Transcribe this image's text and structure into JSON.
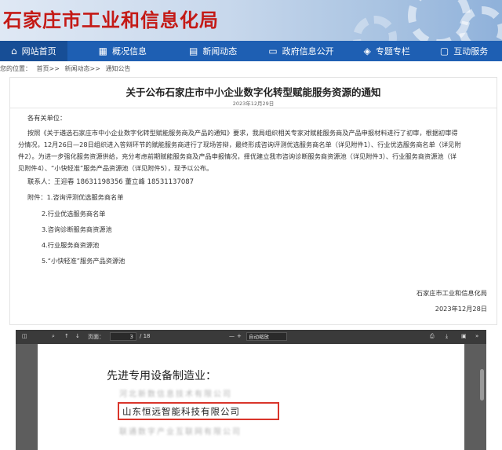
{
  "site": {
    "title": "石家庄市工业和信息化局"
  },
  "nav": [
    {
      "label": "网站首页",
      "icon": "home-icon",
      "glyph": "⌂"
    },
    {
      "label": "概况信息",
      "icon": "grid-icon",
      "glyph": "▦"
    },
    {
      "label": "新闻动态",
      "icon": "newspaper-icon",
      "glyph": "▤"
    },
    {
      "label": "政府信息公开",
      "icon": "monitor-icon",
      "glyph": "▭"
    },
    {
      "label": "专题专栏",
      "icon": "layers-icon",
      "glyph": "◈"
    },
    {
      "label": "互动服务",
      "icon": "chat-icon",
      "glyph": "▢"
    }
  ],
  "breadcrumb": {
    "prefix": "您的位置：",
    "items": [
      "首页>>",
      "新闻动态>>",
      "通知公告"
    ]
  },
  "article": {
    "title": "关于公布石家庄市中小企业数字化转型赋能服务资源的通知",
    "date": "2023年12月29日",
    "greeting": "各有关单位：",
    "lines": [
      "按照《关于遴选石家庄市中小企业数字化转型赋能服务商及产品的通知》要求，我局组织相关专家对赋能服务商及产品申报材料进行了初审，根据初审得",
      "分情况，12月26日—28日组织进入答辩环节的赋能服务商进行了现场答辩，最终形成咨询评测优选服务商名单（详见附件1）、行业优选服务商名单（详见附",
      "件2）。为进一步强化服务资源供给，充分考虑前期赋能服务商及产品申报情况，择优建立我市咨询诊断服务商资源池（详见附件3）、行业服务商资源池（详",
      "见附件4）、“小快轻准”服务产品资源池（详见附件5），现予以公布。"
    ],
    "contact": "联系人：王迎春 18631198356 董立峰 18531137087",
    "attachments": [
      "附件：1.咨询评测优选服务商名单",
      "2.行业优选服务商名单",
      "3.咨询诊断服务商资源池",
      "4.行业服务商资源池",
      "5.“小快轻准”服务产品资源池"
    ],
    "signature": "石家庄市工业和信息化局",
    "sign_date": "2023年12月28日"
  },
  "viewer": {
    "page_label": "页面：",
    "page_value": "3",
    "page_total": "/ 18",
    "zoom": "自动缩放",
    "heading": "先进专用设备制造业：",
    "blurred_rows": [
      "河北新数信息技术有限公司",
      "联通数字产业互联网有限公司"
    ],
    "highlight": "山东恒远智能科技有限公司"
  }
}
